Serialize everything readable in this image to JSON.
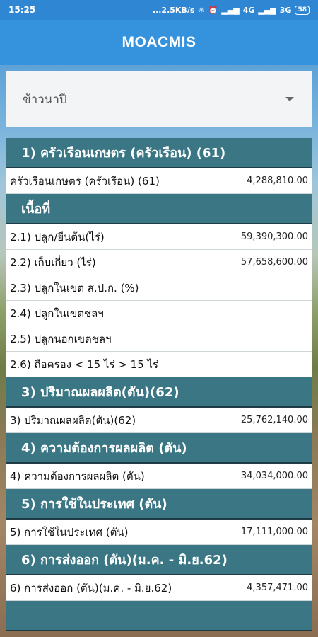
{
  "status_bar": {
    "time": "15:25",
    "network_speed": "...2.5KB/s",
    "signal1": "4G",
    "signal2": "3G",
    "battery": "58"
  },
  "app": {
    "title": "MOACMIS"
  },
  "dropdown": {
    "selected": "ข้าวนาปี"
  },
  "sections": {
    "s1": {
      "header": "1) ครัวเรือนเกษตร (ครัวเรือน) (61)",
      "rows": [
        {
          "label": "ครัวเรือนเกษตร (ครัวเรือน) (61)",
          "value": "4,288,810.00"
        }
      ]
    },
    "s2": {
      "header": "เนื้อที่",
      "rows": [
        {
          "label": "2.1) ปลูก/ยืนต้น(ไร่)",
          "value": "59,390,300.00"
        },
        {
          "label": "2.2) เก็บเกี่ยว (ไร่)",
          "value": "57,658,600.00"
        },
        {
          "label": "2.3) ปลูกในเขต ส.ป.ก. (%)",
          "value": ""
        },
        {
          "label": "2.4) ปลูกในเขตชลฯ",
          "value": ""
        },
        {
          "label": "2.5) ปลูกนอกเขตชลฯ",
          "value": ""
        },
        {
          "label": "2.6) ถือครอง < 15 ไร่ > 15 ไร่",
          "value": ""
        }
      ]
    },
    "s3": {
      "header": "3) ปริมาณผลผลิต(ตัน)(62)",
      "rows": [
        {
          "label": "3) ปริมาณผลผลิต(ตัน)(62)",
          "value": "25,762,140.00"
        }
      ]
    },
    "s4": {
      "header": "4) ความต้องการผลผลิต (ตัน)",
      "rows": [
        {
          "label": "4) ความต้องการผลผลิต (ตัน)",
          "value": "34,034,000.00"
        }
      ]
    },
    "s5": {
      "header": "5) การใช้ในประเทศ (ตัน)",
      "rows": [
        {
          "label": "5) การใช้ในประเทศ (ตัน)",
          "value": "17,111,000.00"
        }
      ]
    },
    "s6": {
      "header": "6) การส่งออก (ตัน)(ม.ค. - มิ.ย.62)",
      "rows": [
        {
          "label": "6) การส่งออก (ตัน)(ม.ค. - มิ.ย.62)",
          "value": "4,357,471.00"
        }
      ]
    }
  }
}
